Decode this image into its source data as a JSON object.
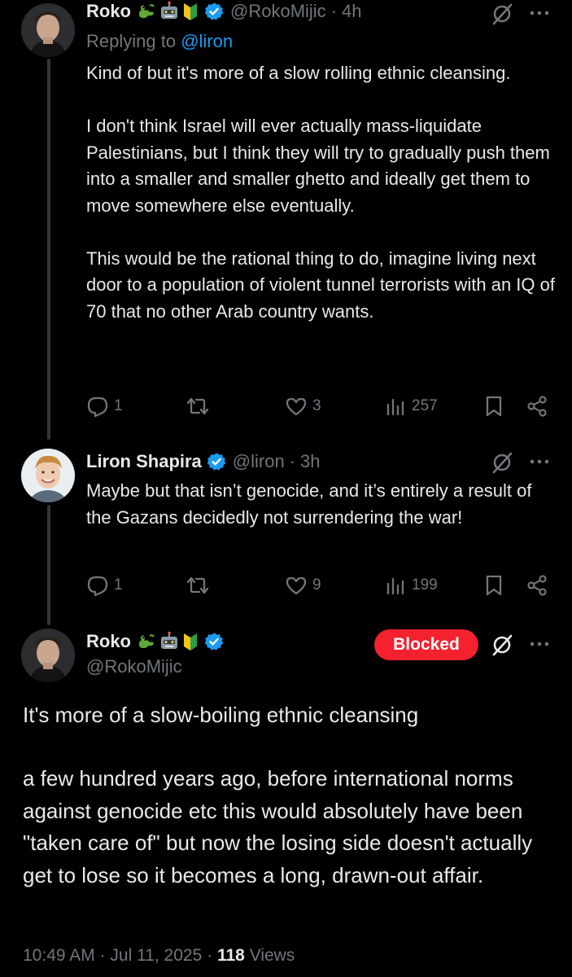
{
  "tweets": [
    {
      "author": {
        "name": "Roko",
        "handle": "@RokoMijic",
        "time": "4h",
        "emojis": [
          "dragon-emoji",
          "robot-emoji",
          "beginner-badge-emoji"
        ]
      },
      "replying_prefix": "Replying to",
      "replying_to": "@liron",
      "paragraphs": [
        "Kind of but it's more of a slow rolling ethnic cleansing.",
        "I don't think Israel will ever actually mass-liquidate Palestinians, but I think they will try to gradually push them into a smaller and smaller ghetto and ideally get them to move somewhere else eventually.",
        "This would be the rational thing to do, imagine living next door to a population of violent tunnel terrorists with an IQ of 70 that no other Arab country wants."
      ],
      "stats": {
        "replies": "1",
        "reposts": "",
        "likes": "3",
        "views": "257"
      }
    },
    {
      "author": {
        "name": "Liron Shapira",
        "handle": "@liron",
        "time": "3h"
      },
      "paragraphs": [
        "Maybe but that isn’t genocide, and it’s entirely a result of the Gazans decidedly not surrendering the war!"
      ],
      "stats": {
        "replies": "1",
        "reposts": "",
        "likes": "9",
        "views": "199"
      }
    }
  ],
  "main_tweet": {
    "author": {
      "name": "Roko",
      "handle": "@RokoMijic",
      "emojis": [
        "dragon-emoji",
        "robot-emoji",
        "beginner-badge-emoji"
      ]
    },
    "blocked_label": "Blocked",
    "paragraphs": [
      "It's more of a slow-boiling ethnic cleansing",
      "a few hundred years ago, before international norms against genocide etc this would absolutely have been \"taken care of\" but now the losing side doesn't actually get to lose so it becomes a long, drawn-out affair."
    ],
    "timestamp": "10:49 AM · Jul 11, 2025",
    "views_count": "118",
    "views_label": "Views"
  },
  "separators": {
    "dot": "·"
  },
  "colors": {
    "background": "#000000",
    "text": "#e7e9ea",
    "secondary": "#71767b",
    "link": "#1d9bf0",
    "blocked": "#f4212e",
    "verified": "#1d9bf0"
  }
}
